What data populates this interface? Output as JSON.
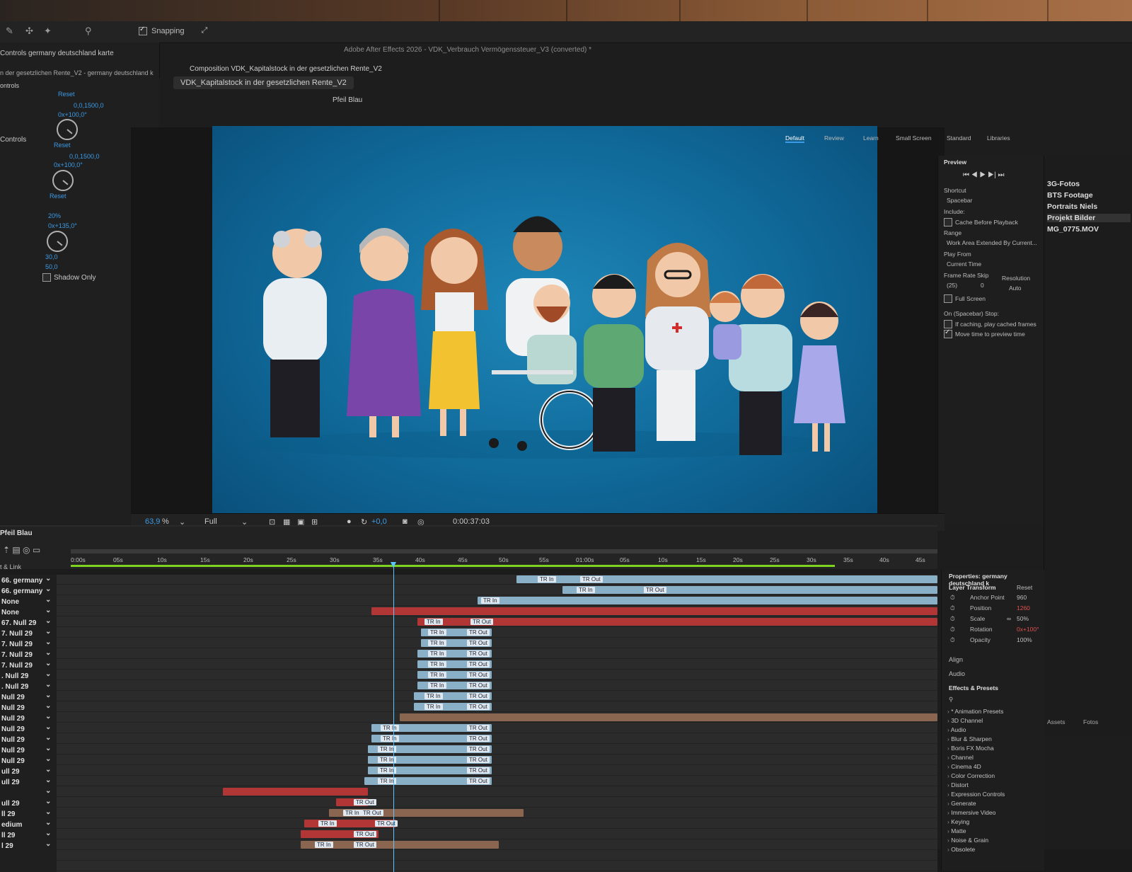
{
  "window": {
    "title": "Adobe After Effects 2026 - VDK_Verbrauch Vermögenssteuer_V3 (converted) *",
    "snapping_label": "Snapping"
  },
  "effect_controls": {
    "panel_title": "Controls germany deutschland karte",
    "subtitle": "n der gesetzlichen Rente_V2 - germany deutschland k",
    "section1": "ontrols",
    "section2": "Controls",
    "reset1": "Reset",
    "reset2": "Reset",
    "reset3": "Reset",
    "val1": "0,0,1500,0",
    "val1b": "0x+100,0°",
    "val2": "0,0,1500,0",
    "val2b": "0x+100,0°",
    "val3": "20%",
    "val3b": "0x+135,0°",
    "val4": "30,0",
    "val5": "50,0",
    "shadow_only": "Shadow Only"
  },
  "composition": {
    "tab_label": "Composition VDK_Kapitalstock in der gesetzlichen Rente_V2",
    "sub_tab": "VDK_Kapitalstock in der gesetzlichen Rente_V2",
    "layer_tab": "Pfeil Blau",
    "zoom": "63,9",
    "zoom_unit": "%",
    "resolution": "Full",
    "exposure": "+0,0",
    "timecode": "0:00:37:03"
  },
  "workspaces": [
    "Default",
    "Review",
    "Learn",
    "Small Screen",
    "Standard",
    "Libraries"
  ],
  "preview": {
    "title": "Preview",
    "shortcut_label": "Shortcut",
    "shortcut_value": "Spacebar",
    "include_label": "Include:",
    "cache_label": "Cache Before Playback",
    "range_label": "Range",
    "range_value": "Work Area Extended By Current...",
    "play_from_label": "Play From",
    "play_from_value": "Current Time",
    "frame_rate_label": "Frame Rate",
    "skip_label": "Skip",
    "resolution_label": "Resolution",
    "frame_rate_value": "(25)",
    "skip_value": "0",
    "resolution_value": "Auto",
    "full_screen": "Full Screen",
    "on_stop": "On (Spacebar) Stop:",
    "if_caching": "If caching, play cached frames",
    "move_time": "Move time to preview time"
  },
  "project_items": [
    "3G-Fotos",
    "BTS Footage",
    "Portraits Niels",
    "Projekt Bilder",
    "MG_0775.MOV"
  ],
  "project_breadcrumb": [
    "Assets",
    "Fotos"
  ],
  "timeline": {
    "comp_name": "Pfeil Blau",
    "column_label": "t & Link",
    "ruler": [
      "0:00s",
      "05s",
      "10s",
      "15s",
      "20s",
      "25s",
      "30s",
      "35s",
      "40s",
      "45s",
      "50s",
      "55s",
      "01:00s",
      "05s",
      "10s",
      "15s",
      "20s",
      "25s",
      "30s",
      "35s",
      "40s",
      "45s"
    ],
    "layers": [
      "66. germany",
      "66. germany",
      "None",
      "None",
      "67. Null 29",
      "7. Null 29",
      "7. Null 29",
      "7. Null 29",
      "7. Null 29",
      ". Null 29",
      ". Null 29",
      "Null 29",
      "Null 29",
      "Null 29",
      "Null 29",
      "Null 29",
      "Null 29",
      "Null 29",
      "ull 29",
      "ull 29",
      "",
      "ull 29",
      "ll 29",
      "edium",
      "ll 29",
      "l 29"
    ],
    "tr_in": "TR In",
    "tr_out": "TR Out"
  },
  "properties": {
    "title": "Properties: germany deutschland k",
    "layer_transform": "Layer Transform",
    "reset": "Reset",
    "anchor_label": "Anchor Point",
    "anchor_value": "960",
    "position_label": "Position",
    "position_value": "1260",
    "scale_label": "Scale",
    "scale_value": "50%",
    "rotation_label": "Rotation",
    "rotation_value": "0x+100°",
    "opacity_label": "Opacity",
    "opacity_value": "100%",
    "align": "Align",
    "audio": "Audio",
    "effects_presets": "Effects & Presets",
    "effects": [
      "* Animation Presets",
      "3D Channel",
      "Audio",
      "Blur & Sharpen",
      "Boris FX Mocha",
      "Channel",
      "Cinema 4D",
      "Color Correction",
      "Distort",
      "Expression Controls",
      "Generate",
      "Immersive Video",
      "Keying",
      "Matte",
      "Noise & Grain",
      "Obsolete"
    ]
  },
  "colors": {
    "accent_blue": "#3b9be8",
    "canvas_blue": "#1e87b8",
    "bar_light_blue": "#8ab0c8",
    "bar_red": "#b23636",
    "playhead": "#5ec4ff"
  }
}
